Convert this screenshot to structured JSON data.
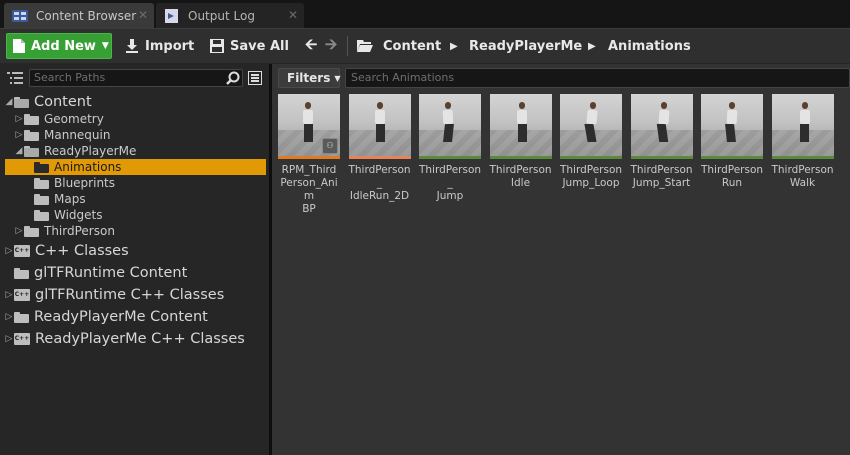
{
  "tabs": [
    {
      "label": "Content Browser",
      "icon": "content-browser-icon"
    },
    {
      "label": "Output Log",
      "icon": "output-log-icon"
    }
  ],
  "toolbar": {
    "add_new": "Add New",
    "import": "Import",
    "save_all": "Save All",
    "breadcrumbs": [
      "Content",
      "ReadyPlayerMe",
      "Animations"
    ]
  },
  "search_paths_placeholder": "Search Paths",
  "search_assets_placeholder": "Search Animations",
  "filters_label": "Filters",
  "tree": [
    {
      "label": "Content"
    },
    {
      "label": "Geometry"
    },
    {
      "label": "Mannequin"
    },
    {
      "label": "ReadyPlayerMe"
    },
    {
      "label": "Animations"
    },
    {
      "label": "Blueprints"
    },
    {
      "label": "Maps"
    },
    {
      "label": "Widgets"
    },
    {
      "label": "ThirdPerson"
    },
    {
      "label": "C++ Classes"
    },
    {
      "label": "glTFRuntime Content"
    },
    {
      "label": "glTFRuntime C++ Classes"
    },
    {
      "label": "ReadyPlayerMe Content"
    },
    {
      "label": "ReadyPlayerMe C++ Classes"
    }
  ],
  "assets": [
    {
      "label": "RPM_ThirdPerson_AnimBP",
      "type_color": "#e07b22"
    },
    {
      "label": "ThirdPerson_IdleRun_2D",
      "type_color": "#e5835a"
    },
    {
      "label": "ThirdPerson_Jump",
      "type_color": "#5c8a3c"
    },
    {
      "label": "ThirdPersonIdle",
      "type_color": "#5c8a3c"
    },
    {
      "label": "ThirdPersonJump_Loop",
      "type_color": "#5c8a3c"
    },
    {
      "label": "ThirdPersonJump_Start",
      "type_color": "#5c8a3c"
    },
    {
      "label": "ThirdPersonRun",
      "type_color": "#5c8a3c"
    },
    {
      "label": "ThirdPersonWalk",
      "type_color": "#5c8a3c"
    }
  ],
  "asset_label_lines": [
    [
      "RPM_Third",
      "Person_Anim",
      "BP"
    ],
    [
      "ThirdPerson_",
      "IdleRun_2D"
    ],
    [
      "ThirdPerson_",
      "Jump"
    ],
    [
      "ThirdPerson",
      "Idle"
    ],
    [
      "ThirdPerson",
      "Jump_Loop"
    ],
    [
      "ThirdPerson",
      "Jump_Start"
    ],
    [
      "ThirdPerson",
      "Run"
    ],
    [
      "ThirdPerson",
      "Walk"
    ]
  ],
  "colors": {
    "accent_green": "#37a035",
    "selection": "#e19a06"
  }
}
